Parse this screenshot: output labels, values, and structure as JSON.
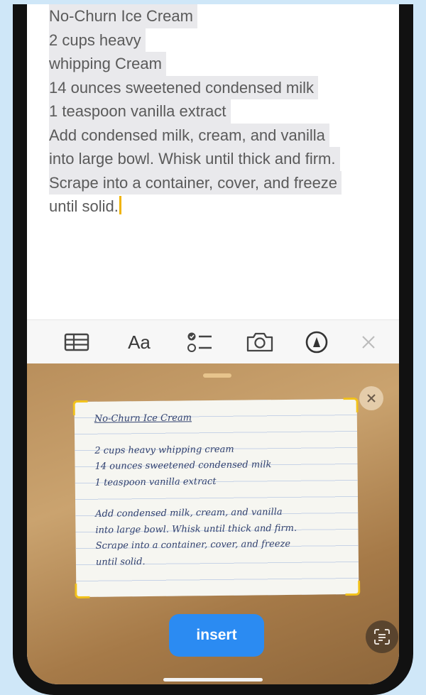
{
  "note": {
    "lines": [
      "No-Churn Ice Cream",
      "2 cups heavy",
      "whipping Cream",
      "14 ounces sweetened condensed milk",
      "1 teaspoon vanilla extract",
      "Add condensed milk, cream, and vanilla",
      "into large bowl. Whisk until thick and firm.",
      "Scrape into a container, cover, and freeze",
      "until solid."
    ]
  },
  "toolbar": {
    "format_label": "Aa",
    "icons": [
      "table-icon",
      "checklist-icon",
      "camera-icon",
      "markup-icon",
      "close-icon"
    ]
  },
  "scan": {
    "paper_lines": [
      "No-Churn Ice Cream",
      "",
      "2 cups heavy whipping cream",
      "14 ounces sweetened condensed milk",
      "1 teaspoon vanilla extract",
      "",
      "Add condensed milk, cream, and vanilla",
      "into large bowl. Whisk until thick and firm.",
      "Scrape into a container, cover, and freeze",
      "until solid."
    ],
    "insert_label": "insert"
  },
  "colors": {
    "accent": "#2b8bf2",
    "selection": "#e9e9ec",
    "caret": "#f0b400",
    "scan_corner": "#f2c21a"
  }
}
